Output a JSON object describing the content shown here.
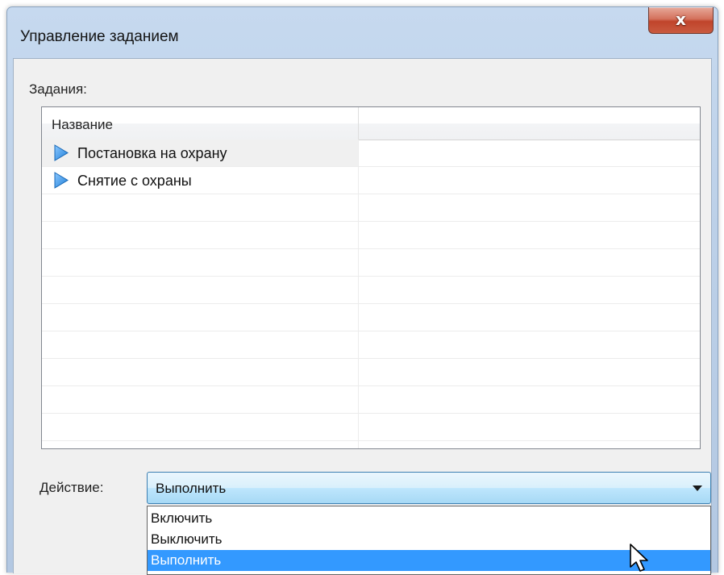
{
  "window": {
    "title": "Управление заданием",
    "close_glyph": "x"
  },
  "tasks": {
    "label": "Задания:",
    "columns": [
      "Название",
      ""
    ],
    "items": [
      {
        "name": "Постановка на охрану",
        "icon": "play-triangle-icon",
        "selected": true
      },
      {
        "name": "Снятие с охраны",
        "icon": "play-triangle-icon",
        "selected": false
      }
    ]
  },
  "action": {
    "label": "Действие:",
    "value": "Выполнить",
    "options": [
      "Включить",
      "Выключить",
      "Выполнить"
    ],
    "highlighted": "Выполнить"
  },
  "colors": {
    "accent": "#3399ff",
    "task_icon": "#1e7fd8"
  }
}
